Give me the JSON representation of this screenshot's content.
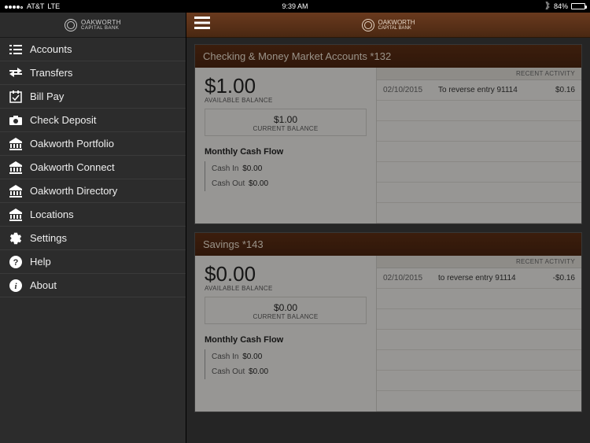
{
  "statusbar": {
    "carrier": "AT&T",
    "network": "LTE",
    "time": "9:39 AM",
    "battery_pct": "84%"
  },
  "brand": {
    "name_line1": "OAKWORTH",
    "name_line2": "CAPITAL BANK"
  },
  "nav": {
    "items": [
      {
        "id": "accounts",
        "label": "Accounts",
        "icon": "list"
      },
      {
        "id": "transfers",
        "label": "Transfers",
        "icon": "transfer"
      },
      {
        "id": "billpay",
        "label": "Bill Pay",
        "icon": "calendar"
      },
      {
        "id": "checkdeposit",
        "label": "Check Deposit",
        "icon": "camera"
      },
      {
        "id": "portfolio",
        "label": "Oakworth Portfolio",
        "icon": "bank"
      },
      {
        "id": "connect",
        "label": "Oakworth Connect",
        "icon": "bank"
      },
      {
        "id": "directory",
        "label": "Oakworth Directory",
        "icon": "bank"
      },
      {
        "id": "locations",
        "label": "Locations",
        "icon": "bank"
      },
      {
        "id": "settings",
        "label": "Settings",
        "icon": "gear"
      },
      {
        "id": "help",
        "label": "Help",
        "icon": "help"
      },
      {
        "id": "about",
        "label": "About",
        "icon": "info"
      }
    ]
  },
  "labels": {
    "available_balance": "AVAILABLE BALANCE",
    "current_balance": "CURRENT BALANCE",
    "monthly_cash_flow": "Monthly Cash Flow",
    "cash_in": "Cash In",
    "cash_out": "Cash Out",
    "recent_activity": "RECENT ACTIVITY"
  },
  "accounts": [
    {
      "title": "Checking & Money Market Accounts *132",
      "available": "$1.00",
      "current": "$1.00",
      "cash_in": "$0.00",
      "cash_out": "$0.00",
      "activity": [
        {
          "date": "02/10/2015",
          "desc": "To reverse entry 91114",
          "amount": "$0.16"
        }
      ]
    },
    {
      "title": "Savings *143",
      "available": "$0.00",
      "current": "$0.00",
      "cash_in": "$0.00",
      "cash_out": "$0.00",
      "activity": [
        {
          "date": "02/10/2015",
          "desc": "to reverse entry 91114",
          "amount": "-$0.16"
        }
      ]
    }
  ]
}
